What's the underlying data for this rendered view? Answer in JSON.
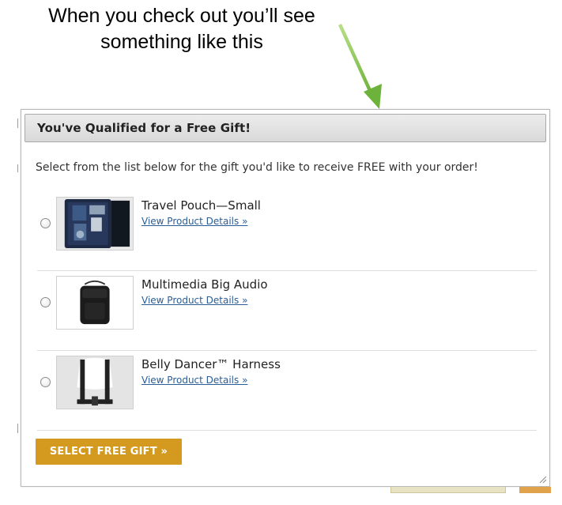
{
  "caption": {
    "line1": "When you check out you’ll see",
    "line2": "something like this"
  },
  "arrow": {
    "icon": "arrow-down-icon",
    "color": "#7dc243"
  },
  "modal": {
    "title": "You've Qualified for a Free Gift!",
    "intro": "Select from the list below for the gift you'd like to receive FREE with your order!",
    "items": [
      {
        "name": "Travel Pouch—Small",
        "link": "View Product Details »",
        "image": "travel-pouch-image",
        "selected": false
      },
      {
        "name": "Multimedia Big Audio",
        "link": "View Product Details »",
        "image": "audio-bag-image",
        "selected": false
      },
      {
        "name": "Belly Dancer™ Harness",
        "link": "View Product Details »",
        "image": "harness-image",
        "selected": false
      }
    ],
    "submit_label": "SELECT FREE GIFT »",
    "submit_color": "#d49a1f",
    "link_color": "#2a5d96"
  }
}
